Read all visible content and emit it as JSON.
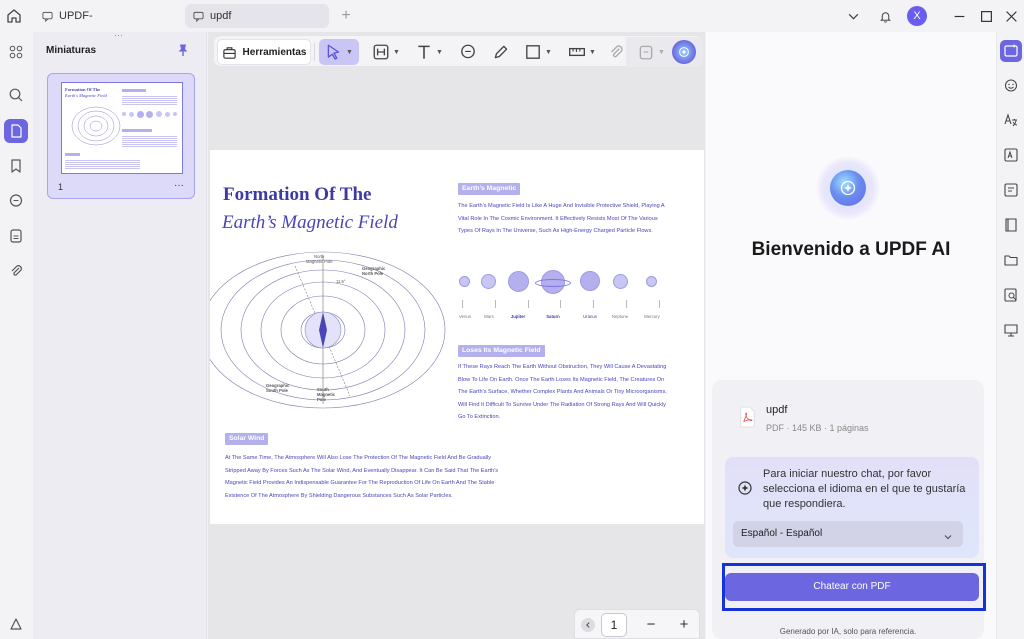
{
  "titlebar": {
    "tabs": [
      {
        "label": "UPDF-"
      },
      {
        "label": "updf"
      }
    ],
    "new_tab": "+",
    "avatar_initial": "X"
  },
  "thumbnails": {
    "title": "Miniaturas",
    "page_number": "1",
    "more": "···",
    "thumb_title": "Formation Of The",
    "thumb_subtitle": "Earth's Magnetic Field"
  },
  "toolbar": {
    "tools_label": "Herramientas"
  },
  "document": {
    "title": "Formation Of The",
    "subtitle": "Earth’s Magnetic Field",
    "diagram_labels": {
      "north_magnetic": "North\nMagnetic Pole",
      "north_geographic": "Geographic\nNorth Pole",
      "angle": "11.5°",
      "south_geographic": "Geographic\nSouth Pole",
      "south_magnetic": "South\nMagnetic\nPole"
    },
    "section1_heading": "Earth’s Magnetic",
    "section1_text": "The Earth’s Magnetic Field Is Like A Huge And Invisible Protective Shield, Playing A Vital Role In The Cosmic Environment. It Effectively Resists Most Of The Various Types Of Rays In The Universe, Such As High-Energy Charged Particle Flows.",
    "planets": [
      "Venus",
      "Mars",
      "Jupiter",
      "Saturn",
      "Uranus",
      "Neptune",
      "Mercury"
    ],
    "section2_heading": "Loses Its Magnetic Field",
    "section2_text": "If These Rays Reach The Earth Without Obstruction, They Will Cause A Devastating Blow To Life On Earth. Once The Earth Loses Its Magnetic Field, The Creatures On The Earth’s Surface, Whether Complex Plants And Animals Or Tiny Microorganisms, Will Find It Difficult To Survive Under The Radiation Of Strong Rays And Will Quickly Go To Extinction.",
    "section3_heading": "Solar Wind",
    "section3_text": "At The Same Time, The Atmosphere Will Also Lose The Protection Of The Magnetic Field And Be Gradually Stripped Away By Forces Such As The Solar Wind, And Eventually Disappear. It Can Be Said That The Earth’s Magnetic Field Provides An Indispensable Guarantee For The Reproduction Of Life On Earth And The Stable Existence Of The Atmosphere By Shielding Dangerous Substances Such As Solar Particles."
  },
  "pager": {
    "current_page": "1",
    "zoom_out": "−",
    "zoom_in": "+"
  },
  "ai": {
    "welcome": "Bienvenido a UPDF AI",
    "file_name": "updf",
    "file_meta": "PDF · 145 KB · 1 páginas",
    "prompt": "Para iniciar nuestro chat, por favor selecciona el idioma en el que te gustaría que respondiera.",
    "language": "Español - Español",
    "chat_button": "Chatear con PDF",
    "footer": "Generado por IA, solo para referencia."
  },
  "colors": {
    "accent": "#6c67e0",
    "accent_light": "#dcdaf8",
    "page_text": "#4a46b8"
  }
}
